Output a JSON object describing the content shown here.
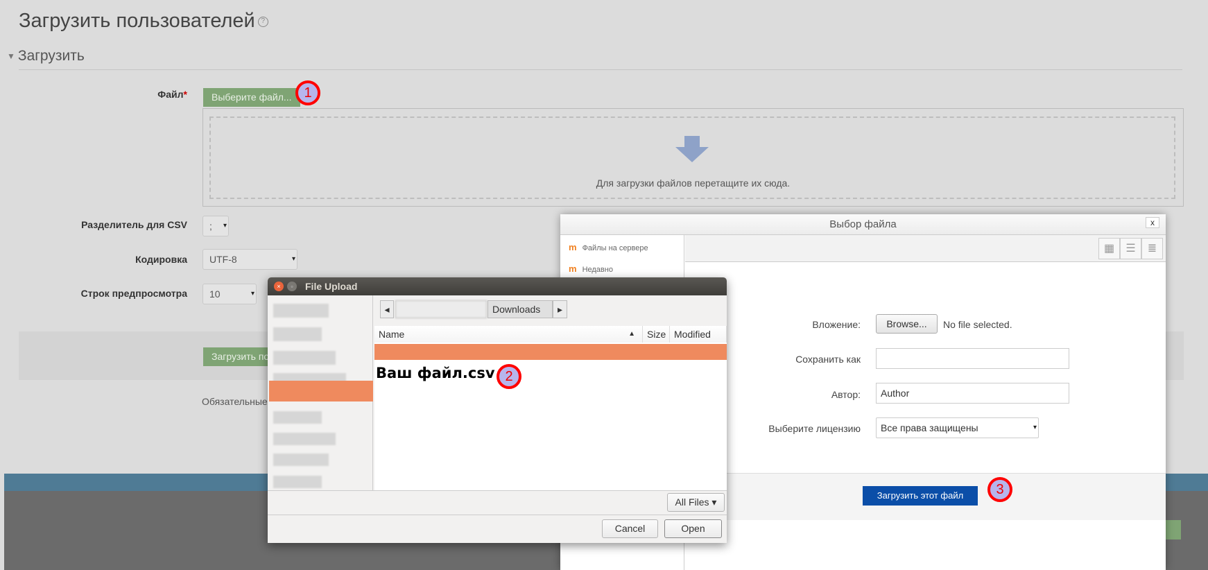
{
  "page": {
    "title": "Загрузить пользователей",
    "section": "Загрузить",
    "file_label": "Файл",
    "required_mark": "*",
    "choose_file_button": "Выберите файл...",
    "drop_text": "Для загрузки файлов перетащите их сюда.",
    "csv_delimiter_label": "Разделитель для CSV",
    "csv_delimiter_value": ";",
    "encoding_label": "Кодировка",
    "encoding_value": "UTF-8",
    "preview_rows_label": "Строк предпросмотра",
    "preview_rows_value": "10",
    "upload_button": "Загрузить по",
    "required_note": "Обязательные"
  },
  "file_picker": {
    "title": "Выбор файла",
    "close": "x",
    "repositories": [
      {
        "label": "Файлы на сервере",
        "icon": "moodle-icon"
      },
      {
        "label": "Недавно",
        "icon": "moodle-icon"
      }
    ],
    "attachment_label": "Вложение:",
    "browse_button": "Browse...",
    "no_file": "No file selected.",
    "save_as_label": "Сохранить как",
    "save_as_value": "",
    "author_label": "Автор:",
    "author_value": "Author",
    "license_label": "Выберите лицензию",
    "license_value": "Все права защищены",
    "upload_button": "Загрузить этот файл"
  },
  "file_upload": {
    "title": "File Upload",
    "path_current": "Downloads",
    "columns": {
      "name": "Name",
      "size": "Size",
      "modified": "Modified"
    },
    "file_name": "Ваш файл.csv",
    "filter": "All Files",
    "cancel": "Cancel",
    "open": "Open"
  },
  "badges": [
    "1",
    "2",
    "3"
  ],
  "colors": {
    "badge_fill": "#b7b5ec",
    "badge_ring": "#ff0000",
    "selection": "#ef8a5e",
    "primary": "#0b4ea8",
    "green": "#7fa474"
  }
}
